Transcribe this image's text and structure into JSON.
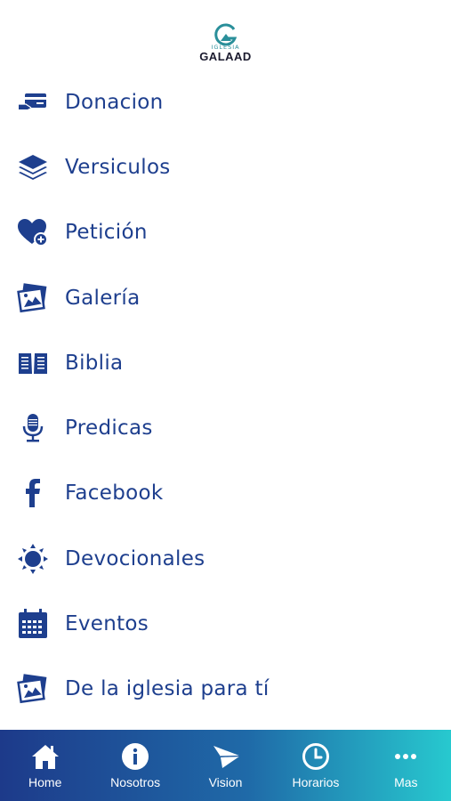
{
  "header": {
    "logo_small": "IGLESIA",
    "logo_big": "GALAAD"
  },
  "colors": {
    "accent": "#1e3f8e",
    "tabbar_start": "#1d3a8a",
    "tabbar_end": "#27c9cf"
  },
  "menu": {
    "items": [
      {
        "label": "Donacion",
        "icon": "donation-card-icon"
      },
      {
        "label": "Versiculos",
        "icon": "layers-icon"
      },
      {
        "label": "Petición",
        "icon": "heart-plus-icon"
      },
      {
        "label": "Galería",
        "icon": "photo-gallery-icon"
      },
      {
        "label": "Biblia",
        "icon": "open-book-icon"
      },
      {
        "label": "Predicas",
        "icon": "microphone-icon"
      },
      {
        "label": "Facebook",
        "icon": "facebook-icon"
      },
      {
        "label": "Devocionales",
        "icon": "sun-icon"
      },
      {
        "label": "Eventos",
        "icon": "calendar-icon"
      },
      {
        "label": "De la iglesia para tí",
        "icon": "photo-gallery-icon"
      }
    ]
  },
  "tabbar": {
    "tabs": [
      {
        "label": "Home",
        "icon": "home-icon"
      },
      {
        "label": "Nosotros",
        "icon": "info-icon"
      },
      {
        "label": "Vision",
        "icon": "paper-plane-icon"
      },
      {
        "label": "Horarios",
        "icon": "clock-icon"
      },
      {
        "label": "Mas",
        "icon": "more-dots-icon"
      }
    ]
  }
}
